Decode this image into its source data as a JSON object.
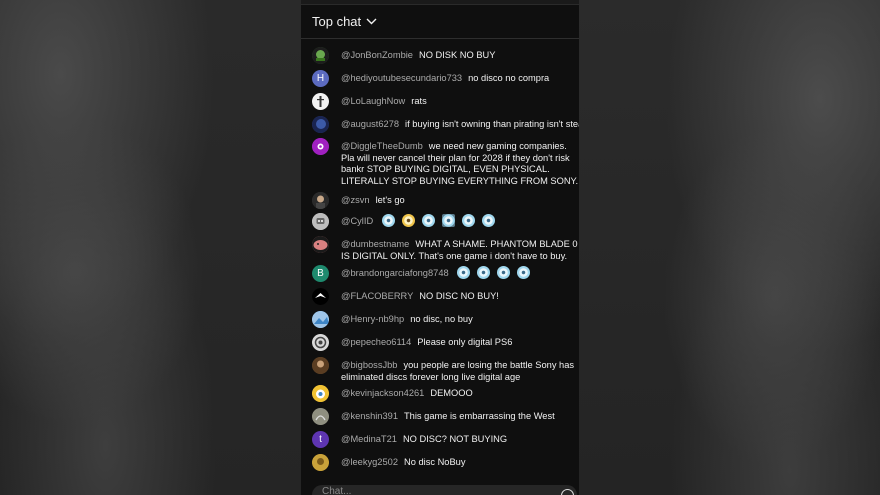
{
  "header": {
    "title": "Top chat"
  },
  "messages": [
    {
      "author": "@JonBonZombie",
      "text": "NO DISK NO BUY",
      "avatar_color": "#2e4f2a",
      "avatar_letter": ""
    },
    {
      "author": "@hediyoutubesecundario733",
      "text": "no disco no compra",
      "avatar_color": "#5c6bc0",
      "avatar_letter": "H"
    },
    {
      "author": "@LoLaughNow",
      "text": "rats",
      "avatar_color": "#f2f2f2",
      "avatar_letter": ""
    },
    {
      "author": "@august6278",
      "text": "if buying isn't owning than pirating isn't steal",
      "avatar_color": "#2c3f7a",
      "avatar_letter": ""
    },
    {
      "author": "@DiggleTheeDumb",
      "text": "we need new gaming companies. Pla will never cancel their plan for 2028 if they don't risk bankr STOP BUYING DIGITAL, EVEN PHYSICAL. LITERALLY STOP BUYING EVERYTHING FROM SONY.",
      "avatar_color": "#9c27b0",
      "avatar_letter": ""
    },
    {
      "author": "@zsvn",
      "text": "let's go",
      "avatar_color": "#3a3a3a",
      "avatar_letter": ""
    },
    {
      "author": "@CylID",
      "text": "",
      "avatar_color": "#c8c8c8",
      "avatar_letter": ""
    },
    {
      "author": "@dumbestname",
      "text": "WHAT A SHAME. PHANTOM BLADE 0 IS DIGITAL ONLY. That's one game i don't have to buy.",
      "avatar_color": "#d07a7a",
      "avatar_letter": ""
    },
    {
      "author": "@brandongarciafong8748",
      "text": "",
      "avatar_color": "#1e8a6e",
      "avatar_letter": "B"
    },
    {
      "author": "@FLACOBERRY",
      "text": "NO DISC NO BUY!",
      "avatar_color": "#111111",
      "avatar_letter": ""
    },
    {
      "author": "@Henry-nb9hp",
      "text": "no disc, no buy",
      "avatar_color": "#6fa8dc",
      "avatar_letter": ""
    },
    {
      "author": "@pepecheo6114",
      "text": "Please only digital PS6",
      "avatar_color": "#8a8a8a",
      "avatar_letter": ""
    },
    {
      "author": "@bigbossJbb",
      "text": "you people are losing the battle Sony has eliminated discs forever long live digital age",
      "avatar_color": "#6b4b2a",
      "avatar_letter": ""
    },
    {
      "author": "@kevinjackson4261",
      "text": "DEMOOO",
      "avatar_color": "#e0b84a",
      "avatar_letter": ""
    },
    {
      "author": "@kenshin391",
      "text": "This game is embarrassing the West",
      "avatar_color": "#7a7a6a",
      "avatar_letter": ""
    },
    {
      "author": "@MedinaT21",
      "text": "NO DISC? NOT BUYING",
      "avatar_color": "#5e35b1",
      "avatar_letter": "t"
    },
    {
      "author": "@leekyg2502",
      "text": "No disc NoBuy",
      "avatar_color": "#b08a2a",
      "avatar_letter": ""
    }
  ],
  "input": {
    "placeholder": "Chat..."
  },
  "icons": {
    "dropdown": "chevron-down-icon",
    "emoji": "emoji-icon",
    "disc_emoji": "disc-emoji-icon"
  }
}
